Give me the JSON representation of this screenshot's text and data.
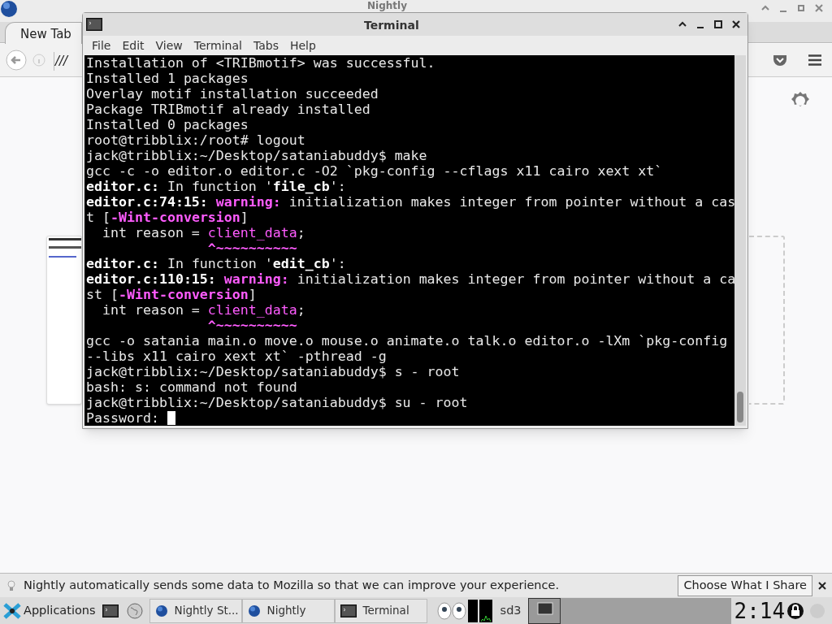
{
  "browser": {
    "title": "Nightly",
    "tab": "New Tab",
    "url": "///"
  },
  "terminal": {
    "title": "Terminal",
    "menu": [
      "File",
      "Edit",
      "View",
      "Terminal",
      "Tabs",
      "Help"
    ],
    "lines": [
      [
        {
          "t": "Installation of <TRIBmotif> was successful.",
          "kind": "plain"
        }
      ],
      [
        {
          "t": "Installed 1 packages",
          "kind": "plain"
        }
      ],
      [
        {
          "t": "Overlay motif installation succeeded",
          "kind": "plain"
        }
      ],
      [
        {
          "t": "Package TRIBmotif already installed",
          "kind": "plain"
        }
      ],
      [
        {
          "t": "Installed 0 packages",
          "kind": "plain"
        }
      ],
      [
        {
          "t": "root@tribblix:/root# logout",
          "kind": "plain"
        }
      ],
      [
        {
          "t": "jack@tribblix:~/Desktop/sataniabuddy$ make",
          "kind": "plain"
        }
      ],
      [
        {
          "t": "gcc -c -o editor.o editor.c -O2 `pkg-config --cflags x11 cairo xext xt`",
          "kind": "plain"
        }
      ],
      [
        {
          "t": "editor.c:",
          "kind": "bold"
        },
        {
          "t": " In function '",
          "kind": "plain"
        },
        {
          "t": "file_cb",
          "kind": "bold"
        },
        {
          "t": "':",
          "kind": "plain"
        }
      ],
      [
        {
          "t": "editor.c:74:15: ",
          "kind": "bold"
        },
        {
          "t": "warning:",
          "kind": "magenta-bold"
        },
        {
          "t": " initialization makes integer from pointer without a cas",
          "kind": "plain"
        }
      ],
      [
        {
          "t": "t [",
          "kind": "plain"
        },
        {
          "t": "-Wint-conversion",
          "kind": "magenta-bold"
        },
        {
          "t": "]",
          "kind": "plain"
        }
      ],
      [
        {
          "t": "  int reason = ",
          "kind": "plain"
        },
        {
          "t": "client_data",
          "kind": "magenta"
        },
        {
          "t": ";",
          "kind": "plain"
        }
      ],
      [
        {
          "t": "               ^~~~~~~~~~~",
          "kind": "magenta-bold"
        }
      ],
      [
        {
          "t": "editor.c:",
          "kind": "bold"
        },
        {
          "t": " In function '",
          "kind": "plain"
        },
        {
          "t": "edit_cb",
          "kind": "bold"
        },
        {
          "t": "':",
          "kind": "plain"
        }
      ],
      [
        {
          "t": "editor.c:110:15: ",
          "kind": "bold"
        },
        {
          "t": "warning:",
          "kind": "magenta-bold"
        },
        {
          "t": " initialization makes integer from pointer without a ca",
          "kind": "plain"
        }
      ],
      [
        {
          "t": "st [",
          "kind": "plain"
        },
        {
          "t": "-Wint-conversion",
          "kind": "magenta-bold"
        },
        {
          "t": "]",
          "kind": "plain"
        }
      ],
      [
        {
          "t": "  int reason = ",
          "kind": "plain"
        },
        {
          "t": "client_data",
          "kind": "magenta"
        },
        {
          "t": ";",
          "kind": "plain"
        }
      ],
      [
        {
          "t": "               ^~~~~~~~~~~",
          "kind": "magenta-bold"
        }
      ],
      [
        {
          "t": "gcc -o satania main.o move.o mouse.o animate.o talk.o editor.o -lXm `pkg-config",
          "kind": "plain"
        }
      ],
      [
        {
          "t": "--libs x11 cairo xext xt` -pthread -g",
          "kind": "plain"
        }
      ],
      [
        {
          "t": "jack@tribblix:~/Desktop/sataniabuddy$ s - root",
          "kind": "plain"
        }
      ],
      [
        {
          "t": "bash: s: command not found",
          "kind": "plain"
        }
      ],
      [
        {
          "t": "jack@tribblix:~/Desktop/sataniabuddy$ su - root",
          "kind": "plain"
        }
      ],
      [
        {
          "t": "Password:",
          "kind": "plain"
        }
      ]
    ]
  },
  "notification": {
    "text": "Nightly automatically sends some data to Mozilla so that we can improve your experience.",
    "button": "Choose What I Share"
  },
  "taskbar": {
    "start": "Applications",
    "tasks": [
      {
        "label": "Nightly St...",
        "kind": "browser",
        "selected": false
      },
      {
        "label": "Nightly",
        "kind": "browser",
        "selected": false
      },
      {
        "label": "Terminal",
        "kind": "terminal",
        "selected": false
      }
    ],
    "disk": "sd3",
    "clock": "2:14"
  }
}
